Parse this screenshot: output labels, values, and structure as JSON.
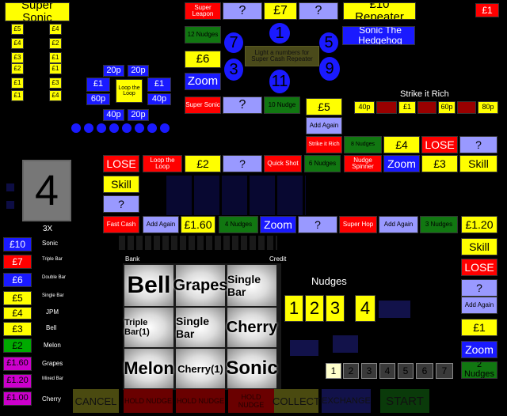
{
  "title": "Super Sonic",
  "stake": "£1",
  "left_ladder": {
    "left": [
      "£5",
      "£4",
      "£3",
      "£2",
      "£1",
      "£1"
    ],
    "right": [
      "£4",
      "£2",
      "£1",
      "£1",
      "£3",
      "£4"
    ]
  },
  "loop": {
    "top": [
      "20p",
      "20p"
    ],
    "left": [
      "£1",
      "60p"
    ],
    "center": "Loop the Loop",
    "right": [
      "£1",
      "40p"
    ],
    "bottom": [
      "40p",
      "20p"
    ]
  },
  "trail_top": {
    "super_leapon": "Super Leapon",
    "q1": "?",
    "seven": "£7",
    "q2": "?",
    "repeater": "£10 Repeater",
    "twelve_nudges": "12 Nudges",
    "six": "£6",
    "zoom": "Zoom",
    "super_sonic": "Super Sonic",
    "q3": "?",
    "ten_nudges": "10 Nudge",
    "sonic_hedgehog": "Sonic The Hedgehog"
  },
  "number_circles": [
    "1",
    "7",
    "5",
    "3",
    "9",
    "11"
  ],
  "light_numbers": "Light a numbers for Super Cash Repeater",
  "strike_rich": {
    "title": "Strike it Rich",
    "values": [
      "40p",
      "",
      "£1",
      "",
      "60p",
      "",
      "80p"
    ]
  },
  "trail_mid": {
    "five": "£5",
    "add_again": "Add Again",
    "strike_rich": "Strike it Rich",
    "eight_nudges": "8 Nudges",
    "four": "£4",
    "lose": "LOSE",
    "q": "?"
  },
  "trail_row": {
    "lose": "LOSE",
    "loop": "Loop the Loop",
    "two": "£2",
    "q": "?",
    "quick_shot": "Quick Shot",
    "six_nudges": "6 Nudges",
    "nudge_spinner": "Nudge Spinner",
    "zoom": "Zoom",
    "three": "£3",
    "skill": "Skill"
  },
  "left_column": {
    "skill": "Skill",
    "q": "?"
  },
  "counter": "4",
  "multiplier": "3X",
  "trail_bottom": {
    "fast_cash": "Fast Cash",
    "add_again": "Add Again",
    "one_sixty": "£1.60",
    "four_nudges": "4 Nudges",
    "zoom": "Zoom",
    "q": "?",
    "super_hop": "Super Hop",
    "add_again2": "Add Again",
    "three_nudges": "3 Nudges"
  },
  "right_column": {
    "one_twenty": "£1.20",
    "skill": "Skill",
    "lose": "LOSE",
    "q": "?",
    "add_again": "Add Again",
    "one": "£1",
    "zoom": "Zoom",
    "two_nudges": "2 Nudges"
  },
  "paytable": [
    {
      "value": "£10",
      "label": "Sonic"
    },
    {
      "value": "£7",
      "label": "Triple Bar"
    },
    {
      "value": "£6",
      "label": "Double Bar"
    },
    {
      "value": "£5",
      "label": "Single Bar"
    },
    {
      "value": "£4",
      "label": "JPM"
    },
    {
      "value": "£3",
      "label": "Bell"
    },
    {
      "value": "£2",
      "label": "Melon"
    },
    {
      "value": "£1.60",
      "label": "Grapes"
    },
    {
      "value": "£1.20",
      "label": "Mixed Bar"
    },
    {
      "value": "£1.00",
      "label": "Cherry"
    }
  ],
  "bank_label": "Bank",
  "credit_label": "Credit",
  "reels": [
    [
      "Bell",
      "Grapes",
      "Single Bar"
    ],
    [
      "Triple Bar(1)",
      "Single Bar",
      "Cherry"
    ],
    [
      "Melon",
      "Cherry(1)",
      "Sonic"
    ]
  ],
  "nudges": {
    "title": "Nudges",
    "numbers": [
      "1",
      "2",
      "3",
      "4"
    ]
  },
  "nudge_steps": [
    "1",
    "2",
    "3",
    "4",
    "5",
    "6",
    "7"
  ],
  "buttons": {
    "cancel": "CANCEL",
    "hold1": "HOLD NUDGE",
    "hold2": "HOLD NUDGE",
    "hold3": "HOLD NUDGE",
    "collect": "COLLECT",
    "exchange": "EXCHANGE",
    "start": "START"
  }
}
